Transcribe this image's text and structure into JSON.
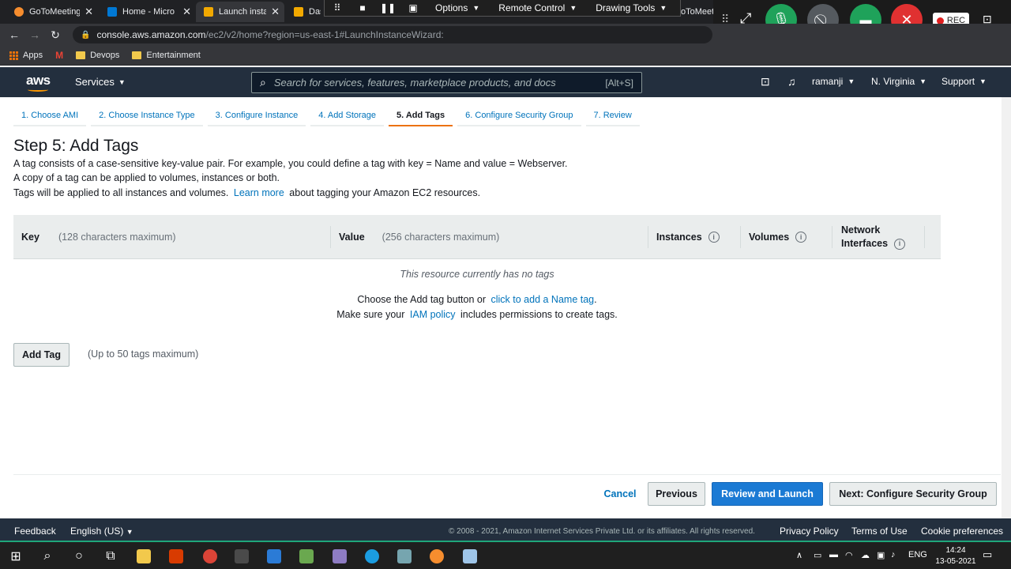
{
  "browser": {
    "tabs": [
      {
        "title": "GoToMeeting",
        "color": "#f68d2e"
      },
      {
        "title": "Home - Micro",
        "color": "#0078d4"
      },
      {
        "title": "Launch instanc",
        "color": "#f2a900"
      },
      {
        "title": "Dash",
        "color": "#f2a900"
      }
    ],
    "tab_partial_right": "oToMeet",
    "url_host": "console.aws.amazon.com",
    "url_path": "/ec2/v2/home?region=us-east-1#LaunchInstanceWizard:",
    "bookmarks": [
      "Apps",
      "Devops",
      "Entertainment"
    ]
  },
  "gotomeeting": {
    "menus": [
      "Options",
      "Remote Control",
      "Drawing Tools"
    ],
    "rec_label": "REC",
    "colors": {
      "mic": "#1fa25a",
      "screen": "#1fa25a",
      "hangup": "#e03131",
      "camera": "#555a5f"
    }
  },
  "aws": {
    "logo": "aws",
    "services": "Services",
    "search_placeholder": "Search for services, features, marketplace products, and docs",
    "search_shortcut": "[Alt+S]",
    "user": "ramanji",
    "region": "N. Virginia",
    "support": "Support",
    "accent": "#ec7211"
  },
  "wizard": {
    "tabs": [
      "1. Choose AMI",
      "2. Choose Instance Type",
      "3. Configure Instance",
      "4. Add Storage",
      "5. Add Tags",
      "6. Configure Security Group",
      "7. Review"
    ],
    "active_index": 4
  },
  "page": {
    "title": "Step 5: Add Tags",
    "line1": "A tag consists of a case-sensitive key-value pair. For example, you could define a tag with key = Name and value = Webserver.",
    "line2": "A copy of a tag can be applied to volumes, instances or both.",
    "line3_pre": "Tags will be applied to all instances and volumes.",
    "line3_link": "Learn more",
    "line3_post": "about tagging your Amazon EC2 resources."
  },
  "table": {
    "key": "Key",
    "key_hint": "(128 characters maximum)",
    "value": "Value",
    "value_hint": "(256 characters maximum)",
    "instances": "Instances",
    "volumes": "Volumes",
    "network_interfaces_1": "Network",
    "network_interfaces_2": "Interfaces",
    "empty_message": "This resource currently has no tags",
    "choose_pre": "Choose the Add tag button or",
    "choose_link": "click to add a Name tag",
    "choose_post": ".",
    "policy_pre": "Make sure your",
    "policy_link": "IAM policy",
    "policy_post": "includes permissions to create tags."
  },
  "actions": {
    "add_tag": "Add Tag",
    "max_note": "(Up to 50 tags maximum)",
    "cancel": "Cancel",
    "previous": "Previous",
    "review_launch": "Review and Launch",
    "next": "Next: Configure Security Group"
  },
  "footer": {
    "feedback": "Feedback",
    "language": "English (US)",
    "copyright": "© 2008 - 2021, Amazon Internet Services Private Ltd. or its affiliates. All rights reserved.",
    "privacy": "Privacy Policy",
    "terms": "Terms of Use",
    "cookies": "Cookie preferences"
  },
  "taskbar": {
    "lang": "ENG",
    "time": "14:24",
    "date": "13-05-2021"
  }
}
